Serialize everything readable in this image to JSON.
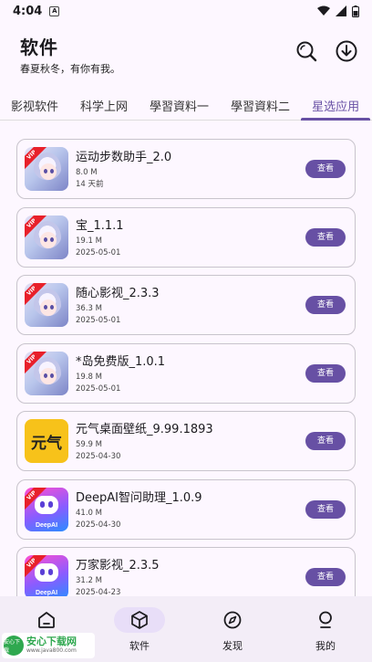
{
  "status": {
    "time": "4:04",
    "notif": "A"
  },
  "header": {
    "title": "软件",
    "subtitle": "春夏秋冬，有你有我。"
  },
  "tabs": [
    {
      "label": "影视软件"
    },
    {
      "label": "科学上网"
    },
    {
      "label": "學習資料一"
    },
    {
      "label": "學習資料二"
    },
    {
      "label": "星选应用"
    }
  ],
  "active_tab": "星选应用",
  "apps": [
    {
      "name": "运动步数助手_2.0",
      "size": "8.0 M",
      "date": "14 天前",
      "icon": "anime-vip",
      "button": "查看"
    },
    {
      "name": "宝_1.1.1",
      "size": "19.1 M",
      "date": "2025-05-01",
      "icon": "anime-vip",
      "button": "查看"
    },
    {
      "name": "随心影视_2.3.3",
      "size": "36.3 M",
      "date": "2025-05-01",
      "icon": "anime-vip",
      "button": "查看"
    },
    {
      "name": "*岛免费版_1.0.1",
      "size": "19.8 M",
      "date": "2025-05-01",
      "icon": "anime-vip",
      "button": "查看"
    },
    {
      "name": "元气桌面壁纸_9.99.1893",
      "size": "59.9 M",
      "date": "2025-04-30",
      "icon": "yuanqi",
      "icon_text": "元气",
      "button": "查看"
    },
    {
      "name": "DeepAI智问助理_1.0.9",
      "size": "41.0 M",
      "date": "2025-04-30",
      "icon": "deepai-vip",
      "icon_text": "DeepAI",
      "button": "查看"
    },
    {
      "name": "万家影视_2.3.5",
      "size": "31.2 M",
      "date": "2025-04-23",
      "icon": "deepai-vip",
      "icon_text": "DeepAI",
      "button": "查看"
    }
  ],
  "vip_label": "VIP",
  "nav": [
    {
      "label": "",
      "icon": "home-icon"
    },
    {
      "label": "软件",
      "icon": "package-icon"
    },
    {
      "label": "发现",
      "icon": "compass-icon"
    },
    {
      "label": "我的",
      "icon": "person-icon"
    }
  ],
  "watermark": {
    "badge": "安心下载",
    "main": "安心下载网",
    "sub": "www.java800.com"
  },
  "colors": {
    "primary": "#6750a4",
    "background": "#fdf7ff",
    "nav_bg": "#f3edf7",
    "active_pill": "#e8def8"
  }
}
